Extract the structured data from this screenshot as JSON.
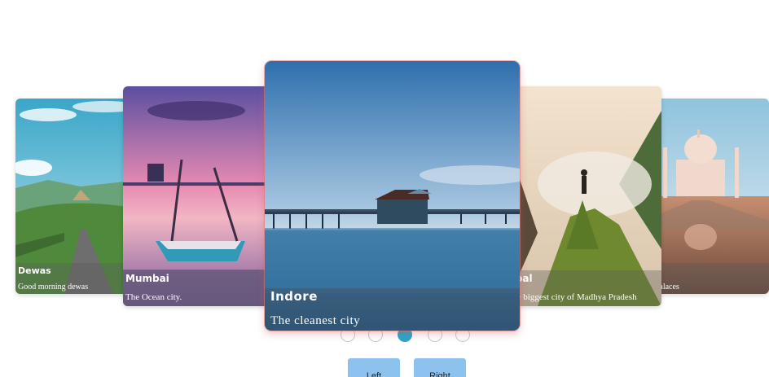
{
  "carousel": {
    "slides": [
      {
        "title": "Dewas",
        "desc": "Good morning dewas"
      },
      {
        "title": "Mumbai",
        "desc": "The Ocean city."
      },
      {
        "title": "Indore",
        "desc": "The cleanest city"
      },
      {
        "title": "hopal",
        "desc": "is the biggest city of Madhya Pradesh"
      },
      {
        "title": "a",
        "desc": "of Palaces"
      }
    ],
    "active_index": 2,
    "dots_count": 5
  },
  "controls": {
    "left_label": "Left",
    "right_label": "Right"
  },
  "colors": {
    "accent_dot": "#2aa6c9",
    "button_bg": "#8ec2ee",
    "card_glow": "#d46a6a"
  }
}
